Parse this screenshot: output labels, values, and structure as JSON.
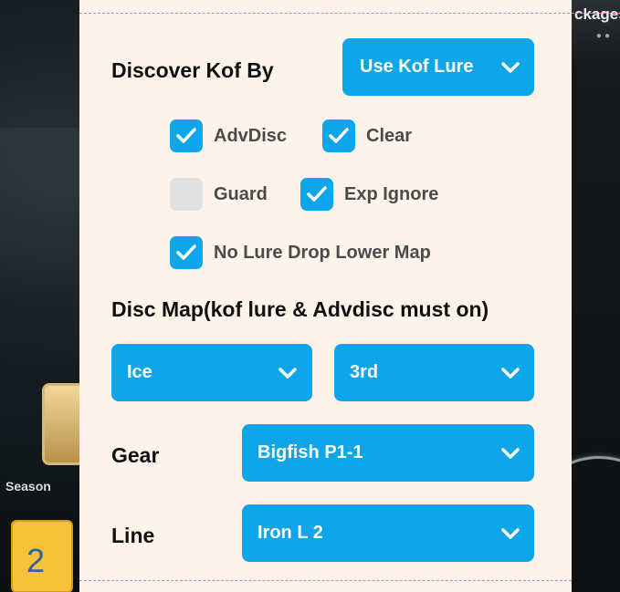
{
  "background": {
    "packages_text": "ckages",
    "season_text": "Season",
    "badge_number": "2"
  },
  "discover": {
    "label": "Discover Kof By",
    "dropdown_value": "Use Kof Lure"
  },
  "options": [
    {
      "label": "AdvDisc",
      "checked": true
    },
    {
      "label": "Clear",
      "checked": true
    },
    {
      "label": "Guard",
      "checked": false
    },
    {
      "label": "Exp Ignore",
      "checked": true
    },
    {
      "label": "No Lure Drop Lower Map",
      "checked": true
    }
  ],
  "disc_map": {
    "label": "Disc Map(kof lure & Advdisc must on)",
    "map_value": "Ice",
    "level_value": "3rd"
  },
  "gear": {
    "label": "Gear",
    "value": "Bigfish P1-1"
  },
  "line": {
    "label": "Line",
    "value": "Iron L 2"
  },
  "colors": {
    "accent": "#0ea5ea",
    "panel": "#fcf3ea",
    "dashed_border": "#e277cc",
    "unchecked": "#e1e1e1"
  }
}
